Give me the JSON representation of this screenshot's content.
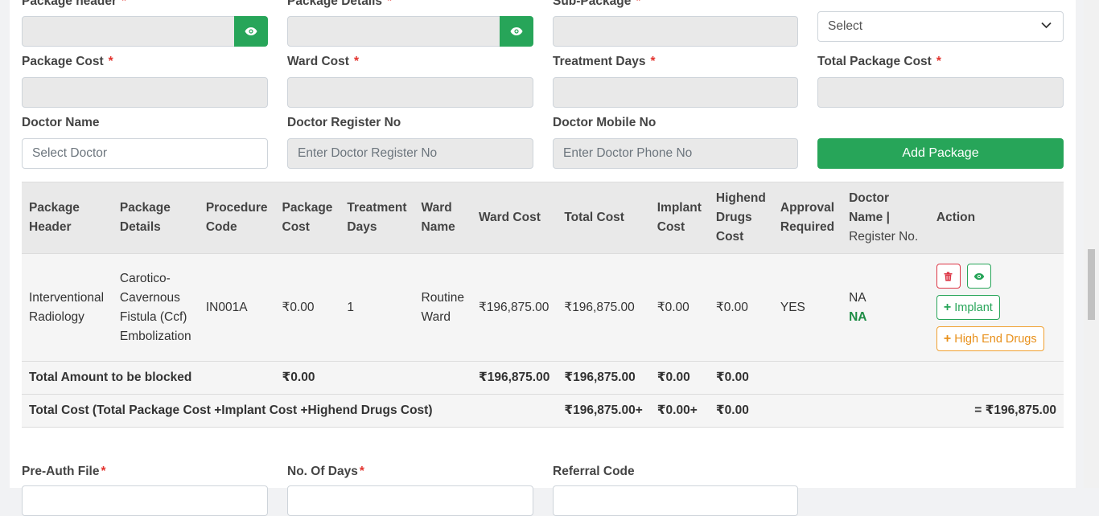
{
  "form": {
    "row1": {
      "package_header": {
        "label": "Package header",
        "required": "*"
      },
      "package_details": {
        "label": "Package Details",
        "required": "*"
      },
      "sub_package": {
        "label": "Sub-Package",
        "required": "*"
      },
      "select_placeholder": "Select"
    },
    "row2": {
      "package_cost": {
        "label": "Package Cost",
        "required": "*"
      },
      "ward_cost": {
        "label": "Ward Cost",
        "required": "*"
      },
      "treatment_days": {
        "label": "Treatment Days",
        "required": "*"
      },
      "total_package_cost": {
        "label": "Total Package Cost",
        "required": "*"
      }
    },
    "row3": {
      "doctor_name": {
        "label": "Doctor Name",
        "placeholder": "Select Doctor"
      },
      "doctor_register_no": {
        "label": "Doctor Register No",
        "placeholder": "Enter Doctor Register No"
      },
      "doctor_mobile_no": {
        "label": "Doctor Mobile No",
        "placeholder": "Enter Doctor Phone No"
      },
      "add_package_button": "Add Package"
    }
  },
  "table": {
    "headers": {
      "package_header": [
        "Package",
        "Header"
      ],
      "package_details": [
        "Package",
        "Details"
      ],
      "procedure_code": [
        "Procedure",
        "Code"
      ],
      "package_cost": [
        "Package",
        "Cost"
      ],
      "treatment_days": [
        "Treatment",
        "Days"
      ],
      "ward_name": [
        "Ward",
        "Name"
      ],
      "ward_cost": "Ward Cost",
      "total_cost": "Total Cost",
      "implant_cost": [
        "Implant",
        "Cost"
      ],
      "highend_drugs_cost": [
        "Highend",
        "Drugs",
        "Cost"
      ],
      "approval_required": [
        "Approval",
        "Required"
      ],
      "doctor_name_register": [
        "Doctor Name |",
        "Register No."
      ],
      "action": "Action"
    },
    "row": {
      "package_header": [
        "Interventional",
        "Radiology"
      ],
      "package_details": [
        "Carotico-",
        "Cavernous",
        "Fistula (Ccf)",
        "Embolization"
      ],
      "procedure_code": "IN001A",
      "package_cost": "₹0.00",
      "treatment_days": "1",
      "ward_name": [
        "Routine",
        "Ward"
      ],
      "ward_cost": "₹196,875.00",
      "total_cost": "₹196,875.00",
      "implant_cost": "₹0.00",
      "highend_drugs_cost": "₹0.00",
      "approval_required": "YES",
      "doctor_name": "NA",
      "doctor_register": "NA",
      "actions": {
        "delete_icon": "trash-icon",
        "view_icon": "eye-icon",
        "implant_label": "Implant",
        "high_end_drugs_label": "High End Drugs"
      }
    },
    "total_blocked": {
      "label": "Total Amount to be blocked",
      "package_cost": "₹0.00",
      "ward_cost": "₹196,875.00",
      "total_cost": "₹196,875.00",
      "implant_cost": "₹0.00",
      "highend_drugs_cost": "₹0.00"
    },
    "total_cost": {
      "label": "Total Cost (Total Package Cost +Implant Cost +Highend Drugs Cost)",
      "total_cost": "₹196,875.00+",
      "implant_cost": "₹0.00+",
      "highend_drugs_cost": "₹0.00",
      "grand_total": "= ₹196,875.00"
    }
  },
  "bottom": {
    "pre_auth_file": {
      "label": "Pre-Auth File",
      "required": "*"
    },
    "no_of_days": {
      "label": "No. Of Days",
      "required": "*"
    },
    "referral_code": {
      "label": "Referral Code"
    }
  },
  "colors": {
    "primary_green": "#27a559",
    "danger_red": "#dc3545",
    "warning_orange": "#f0a030",
    "required_red": "#e3342f"
  }
}
